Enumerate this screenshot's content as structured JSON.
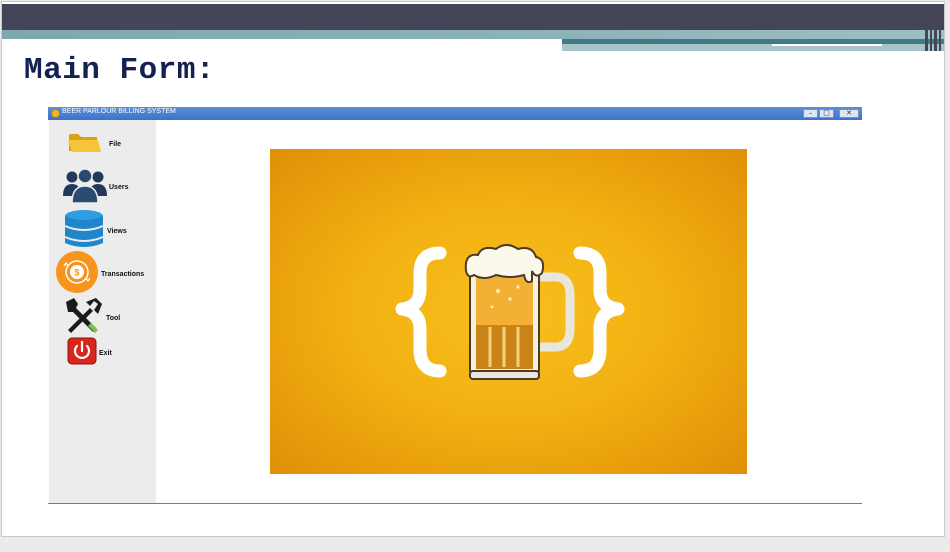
{
  "slide": {
    "title": "Main Form:"
  },
  "window": {
    "title": "BEER PARLOUR BILLING SYSTEM",
    "controls": {
      "minimize": "–",
      "maximize": "□",
      "close": "✕"
    }
  },
  "sidebar": {
    "items": [
      {
        "label": "File",
        "icon": "folder-icon"
      },
      {
        "label": "Users",
        "icon": "users-icon"
      },
      {
        "label": "Views",
        "icon": "database-icon"
      },
      {
        "label": "Transactions",
        "icon": "coin-icon"
      },
      {
        "label": "Tool",
        "icon": "tools-icon"
      },
      {
        "label": "Exit",
        "icon": "power-icon"
      }
    ]
  },
  "splash": {
    "image": "beer-mug-braces-logo"
  },
  "colors": {
    "titlebar": "#3a73c9",
    "slide_title": "#142151",
    "splash_center": "#f7c01d",
    "splash_edge": "#df8f07",
    "header_band": "#444559",
    "accent_teal": "#3f7b84"
  }
}
